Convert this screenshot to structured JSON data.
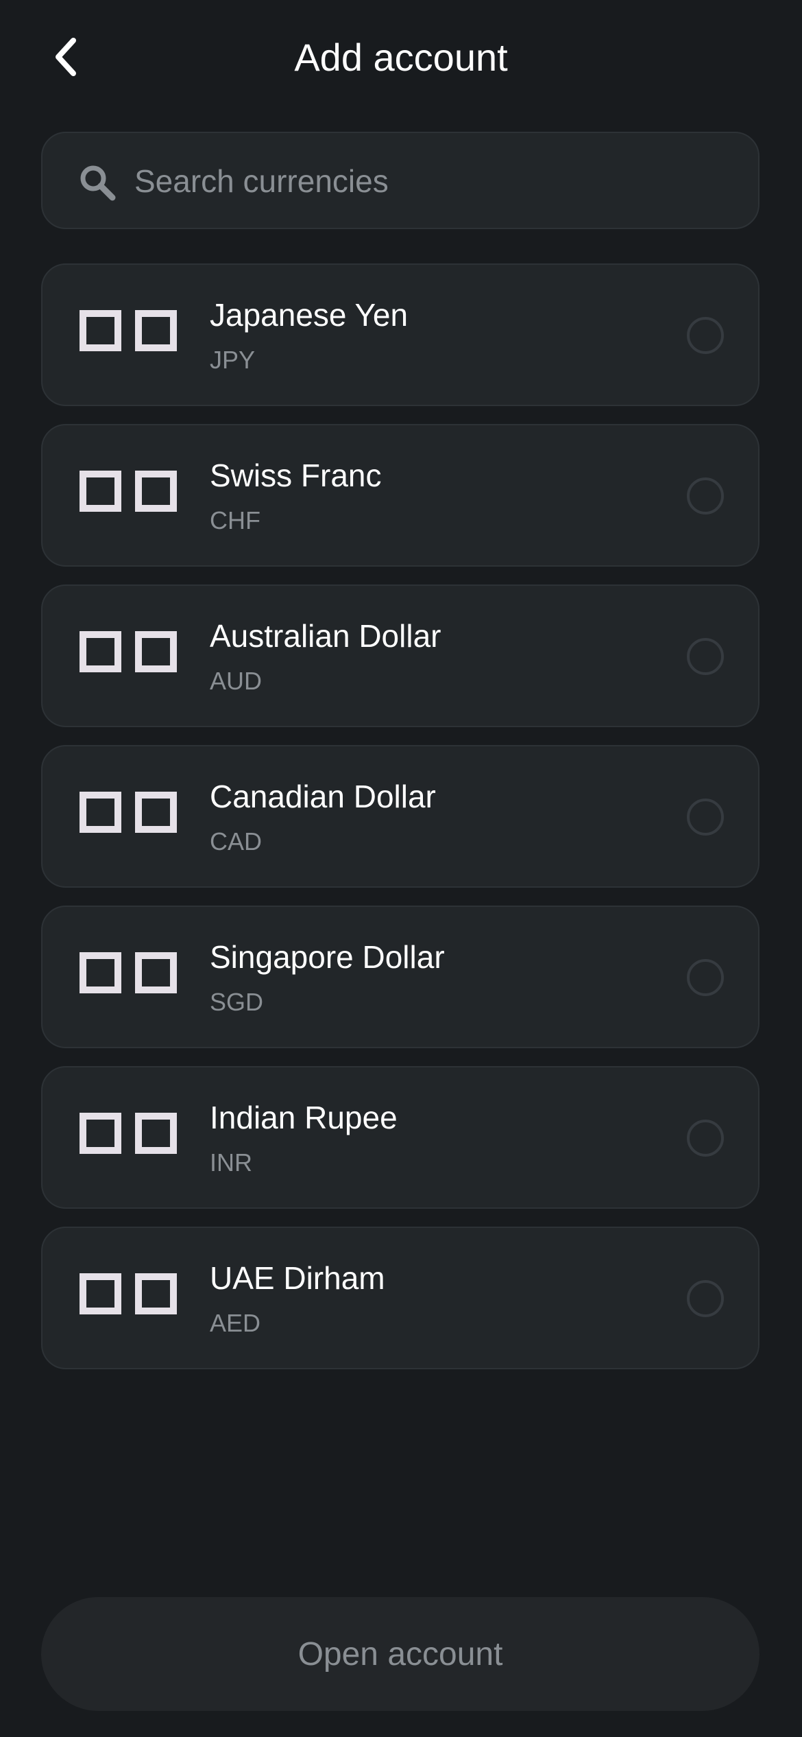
{
  "header": {
    "title": "Add account",
    "back_icon": "chevron-left-icon"
  },
  "search": {
    "placeholder": "Search currencies",
    "value": "",
    "icon": "search-icon"
  },
  "currencies": [
    {
      "name": "Japanese Yen",
      "code": "JPY",
      "selected": false
    },
    {
      "name": "Swiss Franc",
      "code": "CHF",
      "selected": false
    },
    {
      "name": "Australian Dollar",
      "code": "AUD",
      "selected": false
    },
    {
      "name": "Canadian Dollar",
      "code": "CAD",
      "selected": false
    },
    {
      "name": "Singapore Dollar",
      "code": "SGD",
      "selected": false
    },
    {
      "name": "Indian Rupee",
      "code": "INR",
      "selected": false
    },
    {
      "name": "UAE Dirham",
      "code": "AED",
      "selected": false
    }
  ],
  "footer": {
    "open_button_label": "Open account"
  },
  "colors": {
    "background": "#181b1e",
    "card": "#222629",
    "card_border": "#2d3236",
    "text_primary": "#ffffff",
    "text_secondary": "#8a8f94"
  }
}
